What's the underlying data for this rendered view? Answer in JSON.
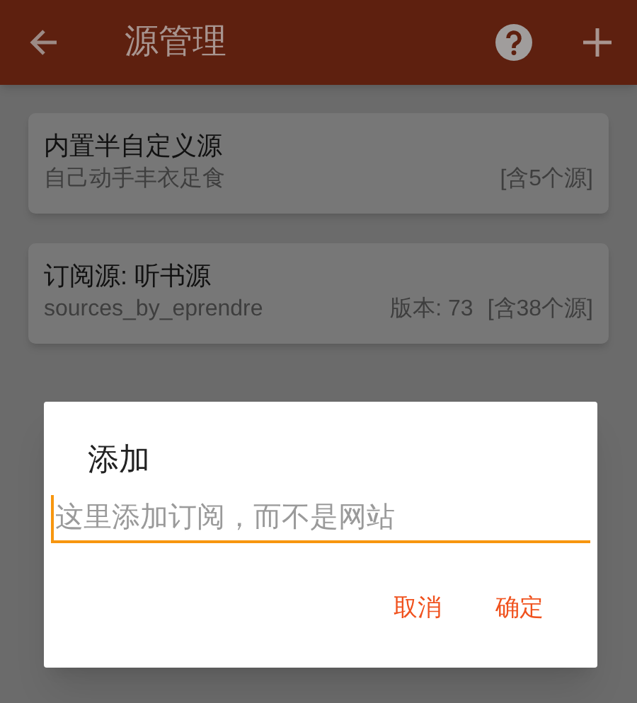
{
  "app_bar": {
    "title": "源管理"
  },
  "sources": [
    {
      "name": "内置半自定义源",
      "subtitle": "自己动手丰衣足食",
      "count": "[含5个源]"
    },
    {
      "name": "订阅源: 听书源",
      "subtitle": "sources_by_eprendre",
      "version": "版本: 73",
      "count": "[含38个源]"
    }
  ],
  "dialog": {
    "title": "添加",
    "field": {
      "placeholder": "这里添加订阅，而不是网站"
    },
    "buttons": [
      "取消",
      "确定"
    ]
  }
}
